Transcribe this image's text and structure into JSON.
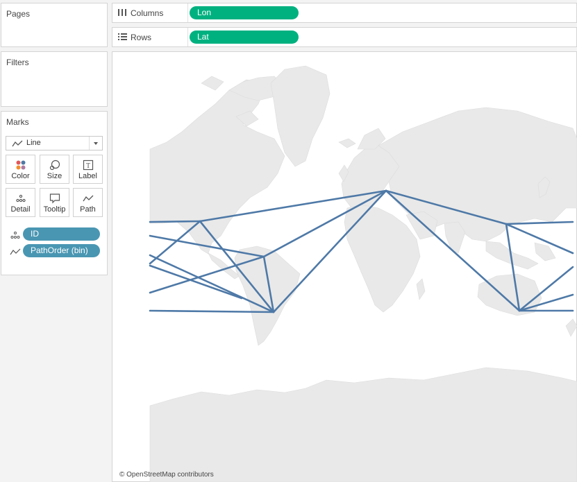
{
  "left_panel": {
    "pages": {
      "title": "Pages"
    },
    "filters": {
      "title": "Filters"
    },
    "marks": {
      "title": "Marks",
      "mark_type": "Line",
      "buttons": [
        {
          "label": "Color",
          "icon": "color-dots-icon"
        },
        {
          "label": "Size",
          "icon": "size-icon"
        },
        {
          "label": "Label",
          "icon": "label-icon"
        },
        {
          "label": "Detail",
          "icon": "detail-icon"
        },
        {
          "label": "Tooltip",
          "icon": "tooltip-icon"
        },
        {
          "label": "Path",
          "icon": "path-icon"
        }
      ],
      "fields": [
        {
          "icon": "detail-icon",
          "label": "ID"
        },
        {
          "icon": "path-icon",
          "label": "PathOrder (bin)"
        }
      ]
    }
  },
  "shelves": {
    "columns": {
      "label": "Columns",
      "pill": "Lon",
      "icon": "columns-icon"
    },
    "rows": {
      "label": "Rows",
      "pill": "Lat",
      "icon": "rows-icon"
    }
  },
  "colors": {
    "dimension_pill": "#4996b2",
    "measure_pill": "#00b180",
    "path_line": "#4e79a7",
    "land": "#e9e9e9"
  },
  "map": {
    "attribution": "© OpenStreetMap contributors"
  }
}
